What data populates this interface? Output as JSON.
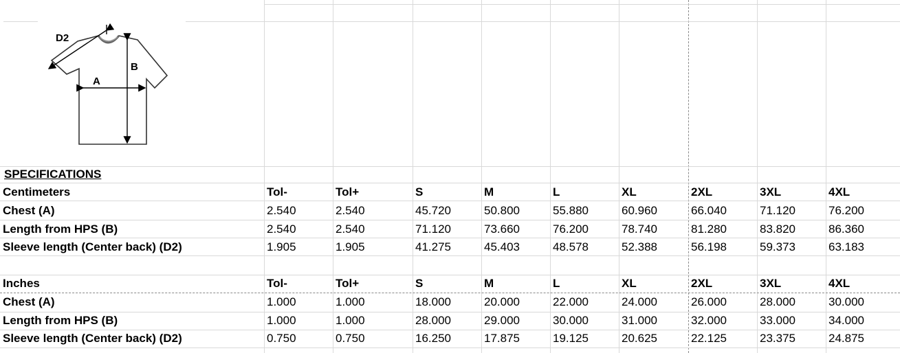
{
  "diagram": {
    "labels": {
      "d2": "D2",
      "a": "A",
      "b": "B"
    }
  },
  "section_title": "SPECIFICATIONS",
  "tables": [
    {
      "unit": "Centimeters",
      "headers": [
        "Tol-",
        "Tol+",
        "S",
        "M",
        "L",
        "XL",
        "2XL",
        "3XL",
        "4XL"
      ],
      "rows": [
        {
          "label": "Chest (A)",
          "values": [
            "2.540",
            "2.540",
            "45.720",
            "50.800",
            "55.880",
            "60.960",
            "66.040",
            "71.120",
            "76.200"
          ]
        },
        {
          "label": "Length from HPS (B)",
          "values": [
            "2.540",
            "2.540",
            "71.120",
            "73.660",
            "76.200",
            "78.740",
            "81.280",
            "83.820",
            "86.360"
          ]
        },
        {
          "label": "Sleeve length (Center back) (D2)",
          "values": [
            "1.905",
            "1.905",
            "41.275",
            "45.403",
            "48.578",
            "52.388",
            "56.198",
            "59.373",
            "63.183"
          ]
        }
      ]
    },
    {
      "unit": "Inches",
      "headers": [
        "Tol-",
        "Tol+",
        "S",
        "M",
        "L",
        "XL",
        "2XL",
        "3XL",
        "4XL"
      ],
      "rows": [
        {
          "label": "Chest (A)",
          "values": [
            "1.000",
            "1.000",
            "18.000",
            "20.000",
            "22.000",
            "24.000",
            "26.000",
            "28.000",
            "30.000"
          ]
        },
        {
          "label": "Length from HPS (B)",
          "values": [
            "1.000",
            "1.000",
            "28.000",
            "29.000",
            "30.000",
            "31.000",
            "32.000",
            "33.000",
            "34.000"
          ]
        },
        {
          "label": "Sleeve length (Center back) (D2)",
          "values": [
            "0.750",
            "0.750",
            "16.250",
            "17.875",
            "19.125",
            "20.625",
            "22.125",
            "23.375",
            "24.875"
          ]
        }
      ]
    }
  ]
}
